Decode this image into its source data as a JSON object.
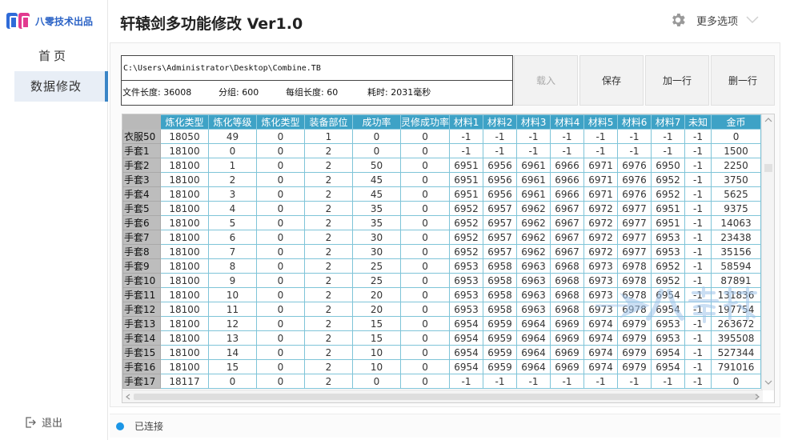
{
  "brand": {
    "name": "八零技术出品"
  },
  "sidebar": {
    "items": [
      {
        "label": "首页"
      },
      {
        "label": "数据修改"
      }
    ],
    "logout_label": "退出"
  },
  "header": {
    "title": "轩辕剑多功能修改  Ver1.0",
    "more_options_label": "更多选项"
  },
  "file": {
    "path": "C:\\Users\\Administrator\\Desktop\\Combine.TB",
    "length_text": "文件长度: 36008",
    "groups_text": "分组: 600",
    "per_group_text": "每组长度: 60",
    "elapsed_text": "耗时: 2031毫秒"
  },
  "toolbar": {
    "load_label": "载入",
    "save_label": "保存",
    "add_row_label": "加一行",
    "delete_row_label": "删一行"
  },
  "grid": {
    "columns": [
      "",
      "炼化类型",
      "炼化等级",
      "炼化类型",
      "装备部位",
      "成功率",
      "灵修成功率",
      "材料1",
      "材料2",
      "材料3",
      "材料4",
      "材料5",
      "材料6",
      "材料7",
      "未知",
      "金币"
    ],
    "rows": [
      [
        "衣服50",
        "18050",
        "49",
        "0",
        "1",
        "0",
        "0",
        "-1",
        "-1",
        "-1",
        "-1",
        "-1",
        "-1",
        "-1",
        "-1",
        "0"
      ],
      [
        "手套1",
        "18100",
        "0",
        "0",
        "2",
        "0",
        "0",
        "-1",
        "-1",
        "-1",
        "-1",
        "-1",
        "-1",
        "-1",
        "-1",
        "1500"
      ],
      [
        "手套2",
        "18100",
        "1",
        "0",
        "2",
        "50",
        "0",
        "6951",
        "6956",
        "6961",
        "6966",
        "6971",
        "6976",
        "6950",
        "-1",
        "2250"
      ],
      [
        "手套3",
        "18100",
        "2",
        "0",
        "2",
        "45",
        "0",
        "6951",
        "6956",
        "6961",
        "6966",
        "6971",
        "6976",
        "6952",
        "-1",
        "3750"
      ],
      [
        "手套4",
        "18100",
        "3",
        "0",
        "2",
        "45",
        "0",
        "6951",
        "6956",
        "6961",
        "6966",
        "6971",
        "6976",
        "6952",
        "-1",
        "5625"
      ],
      [
        "手套5",
        "18100",
        "4",
        "0",
        "2",
        "35",
        "0",
        "6952",
        "6957",
        "6962",
        "6967",
        "6972",
        "6977",
        "6951",
        "-1",
        "9375"
      ],
      [
        "手套6",
        "18100",
        "5",
        "0",
        "2",
        "35",
        "0",
        "6952",
        "6957",
        "6962",
        "6967",
        "6972",
        "6977",
        "6951",
        "-1",
        "14063"
      ],
      [
        "手套7",
        "18100",
        "6",
        "0",
        "2",
        "30",
        "0",
        "6952",
        "6957",
        "6962",
        "6967",
        "6972",
        "6977",
        "6953",
        "-1",
        "23438"
      ],
      [
        "手套8",
        "18100",
        "7",
        "0",
        "2",
        "30",
        "0",
        "6952",
        "6957",
        "6962",
        "6967",
        "6972",
        "6977",
        "6953",
        "-1",
        "35156"
      ],
      [
        "手套9",
        "18100",
        "8",
        "0",
        "2",
        "25",
        "0",
        "6953",
        "6958",
        "6963",
        "6968",
        "6973",
        "6978",
        "6952",
        "-1",
        "58594"
      ],
      [
        "手套10",
        "18100",
        "9",
        "0",
        "2",
        "25",
        "0",
        "6953",
        "6958",
        "6963",
        "6968",
        "6973",
        "6978",
        "6952",
        "-1",
        "87891"
      ],
      [
        "手套11",
        "18100",
        "10",
        "0",
        "2",
        "20",
        "0",
        "6953",
        "6958",
        "6963",
        "6968",
        "6973",
        "6978",
        "6954",
        "-1",
        "131836"
      ],
      [
        "手套12",
        "18100",
        "11",
        "0",
        "2",
        "20",
        "0",
        "6953",
        "6958",
        "6963",
        "6968",
        "6973",
        "6978",
        "6954",
        "-1",
        "197754"
      ],
      [
        "手套13",
        "18100",
        "12",
        "0",
        "2",
        "15",
        "0",
        "6954",
        "6959",
        "6964",
        "6969",
        "6974",
        "6979",
        "6953",
        "-1",
        "263672"
      ],
      [
        "手套14",
        "18100",
        "13",
        "0",
        "2",
        "15",
        "0",
        "6954",
        "6959",
        "6964",
        "6969",
        "6974",
        "6979",
        "6953",
        "-1",
        "395508"
      ],
      [
        "手套15",
        "18100",
        "14",
        "0",
        "2",
        "10",
        "0",
        "6954",
        "6959",
        "6964",
        "6969",
        "6974",
        "6979",
        "6954",
        "-1",
        "527344"
      ],
      [
        "手套16",
        "18100",
        "15",
        "0",
        "2",
        "10",
        "0",
        "6954",
        "6959",
        "6964",
        "6969",
        "6974",
        "6979",
        "6954",
        "-1",
        "791016"
      ],
      [
        "手套17",
        "18117",
        "0",
        "0",
        "2",
        "0",
        "0",
        "-1",
        "-1",
        "-1",
        "-1",
        "-1",
        "-1",
        "-1",
        "-1",
        "0"
      ]
    ]
  },
  "status": {
    "text": "已连接",
    "dot_color": "#1b96e6"
  },
  "colors": {
    "header_bg": "#3ea2c6",
    "row_header_bg": "#bdbdbd",
    "grid_line": "#7fc4d8",
    "active_nav_bg": "#e8eef6",
    "active_nav_bar": "#3a85c6"
  }
}
